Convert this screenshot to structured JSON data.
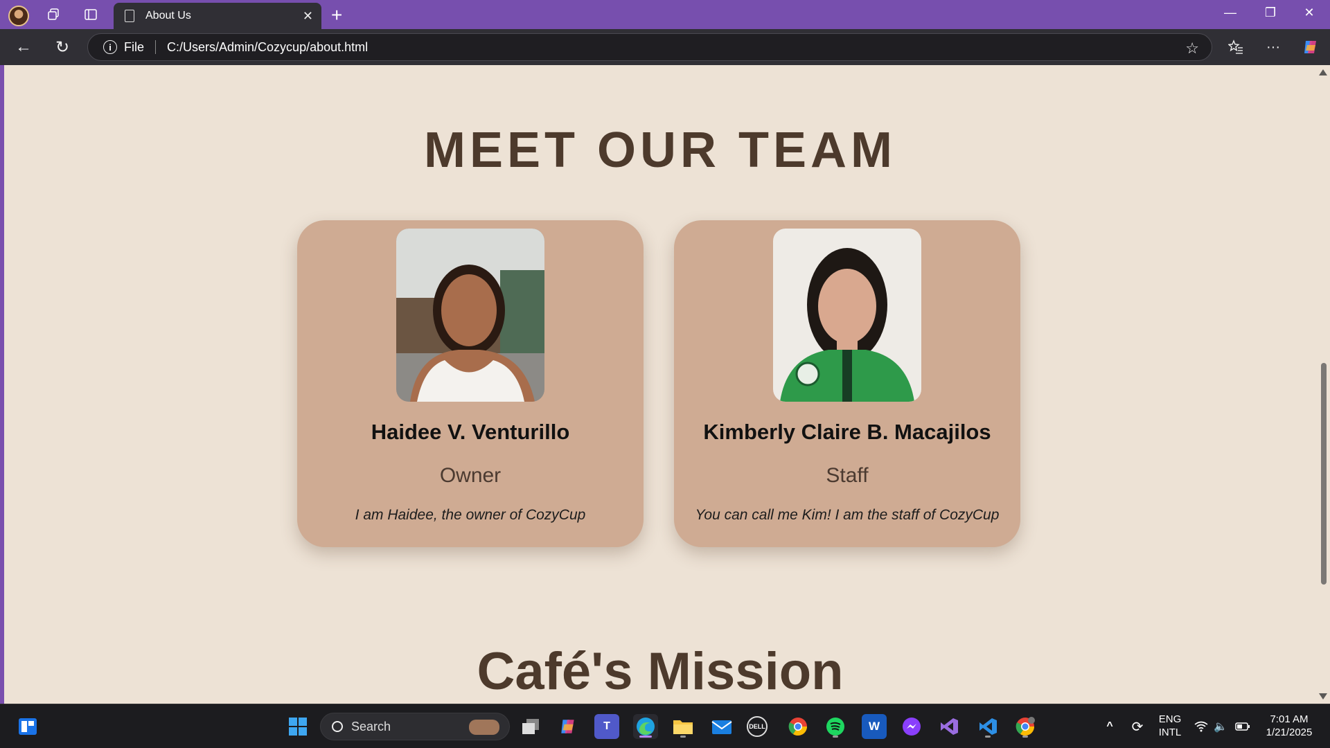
{
  "browser": {
    "tab_title": "About Us",
    "address_scheme": "File",
    "address_url": "C:/Users/Admin/Cozycup/about.html"
  },
  "page": {
    "team_heading": "MEET OUR TEAM",
    "members": [
      {
        "name": "Haidee V. Venturillo",
        "role": "Owner",
        "bio": "I am Haidee, the owner of CozyCup"
      },
      {
        "name": "Kimberly Claire B. Macajilos",
        "role": "Staff",
        "bio": "You can call me Kim! I am the staff of CozyCup"
      }
    ],
    "mission_heading": "Café's Mission"
  },
  "taskbar": {
    "search_placeholder": "Search",
    "language_primary": "ENG",
    "language_secondary": "INTL",
    "time": "7:01 AM",
    "date": "1/21/2025"
  },
  "colors": {
    "titlebar": "#774fae",
    "page_background": "#ede2d5",
    "card_background": "#cfab93",
    "heading": "#4d3a2c"
  }
}
